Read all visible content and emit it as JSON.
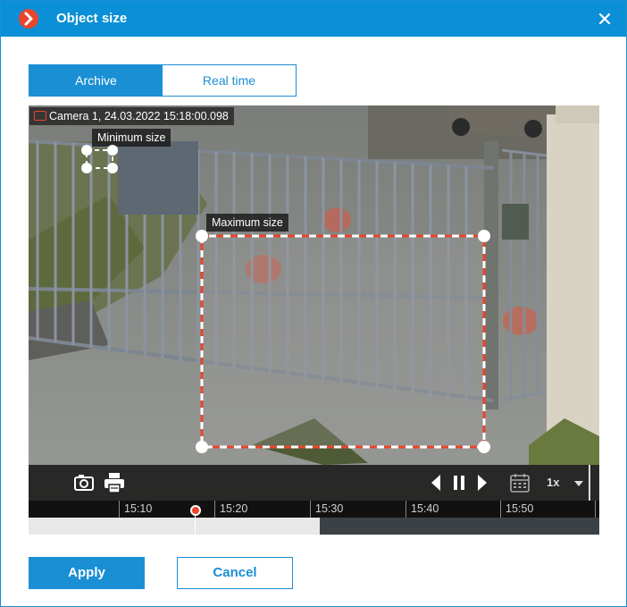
{
  "window": {
    "title": "Object size",
    "close_icon": "close-icon",
    "app_icon": "chevron-right-icon"
  },
  "tabs": [
    {
      "label": "Archive",
      "active": true
    },
    {
      "label": "Real time",
      "active": false
    }
  ],
  "video": {
    "camera_label": "Camera 1, 24.03.2022 15:18:00.098",
    "min_size_label": "Minimum size",
    "max_size_label": "Maximum size"
  },
  "controls": {
    "snapshot_icon": "camera-icon",
    "print_icon": "printer-icon",
    "prev_icon": "step-back-icon",
    "pause_icon": "pause-icon",
    "next_icon": "step-forward-icon",
    "calendar_icon": "calendar-icon",
    "speed": "1x",
    "speed_dropdown_icon": "chevron-down-icon"
  },
  "timeline": {
    "ticks": [
      "15:10",
      "15:20",
      "15:30",
      "15:40",
      "15:50"
    ],
    "archive_fraction": 0.51
  },
  "buttons": {
    "apply": "Apply",
    "cancel": "Cancel"
  },
  "colors": {
    "accent": "#1a8fd4",
    "title_bar": "#0b8fd6",
    "selection_red": "#e8462d"
  }
}
